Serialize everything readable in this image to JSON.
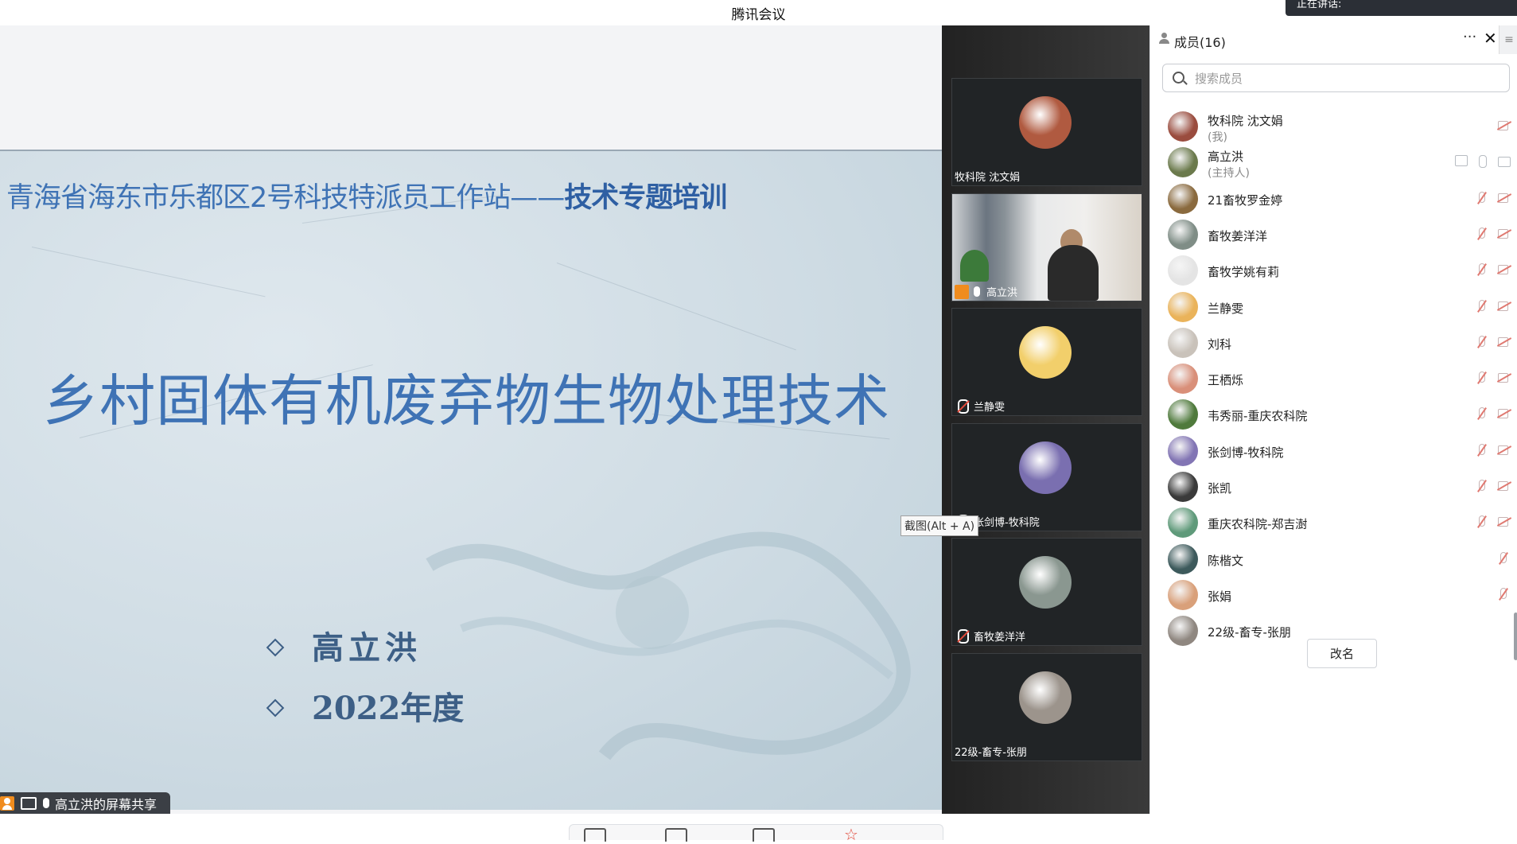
{
  "window": {
    "title": "腾讯会议",
    "recording_text": "正在讲话:"
  },
  "slide": {
    "header_normal": "青海省海东市乐都区2号科技特派员工作站——",
    "header_bold": "技术专题培训",
    "title": "乡村固体有机废弃物生物处理技术",
    "bullets": [
      "高立洪",
      "2022年度"
    ]
  },
  "share_bar": {
    "label": "高立洪的屏幕共享"
  },
  "tooltip": "截图(Alt + A)",
  "gallery": [
    {
      "name": "牧科院 沈文娟",
      "type": "avatar",
      "color": "#b05a40",
      "muted": false
    },
    {
      "name": "高立洪",
      "type": "video",
      "muted": false,
      "host": true
    },
    {
      "name": "兰静雯",
      "type": "avatar",
      "color": "#f2cf6b",
      "muted": true
    },
    {
      "name": "张剑博-牧科院",
      "type": "avatar",
      "color": "#7a6fb0",
      "muted": true
    },
    {
      "name": "畜牧姜洋洋",
      "type": "avatar",
      "color": "#8a9790",
      "muted": true
    },
    {
      "name": "22级-畜专-张朋",
      "type": "avatar",
      "color": "#9c948c",
      "muted": false
    }
  ],
  "panel": {
    "title": "成员(16)",
    "more_icon": "ellipsis-icon",
    "close_icon": "close-icon",
    "search_placeholder": "搜索成员",
    "members": [
      {
        "name": "牧科院 沈文娟",
        "role": "(我)",
        "color": "#9a4c3e",
        "status": "cam-off-only"
      },
      {
        "name": "高立洪",
        "role": "(主持人)",
        "color": "#6b7a4c",
        "status": "host-on"
      },
      {
        "name": "21畜牧罗金婷",
        "role": "",
        "color": "#8a6a3e",
        "status": "muted-cam-off"
      },
      {
        "name": "畜牧姜洋洋",
        "role": "",
        "color": "#7f8d86",
        "status": "muted-cam-off"
      },
      {
        "name": "畜牧学姚有莉",
        "role": "",
        "color": "#e4e4e4",
        "status": "muted-cam-off"
      },
      {
        "name": "兰静雯",
        "role": "",
        "color": "#eab35a",
        "status": "muted-cam-off"
      },
      {
        "name": "刘科",
        "role": "",
        "color": "#c9c2ba",
        "status": "muted-cam-off"
      },
      {
        "name": "王栖烁",
        "role": "",
        "color": "#d98f79",
        "status": "muted-cam-off"
      },
      {
        "name": "韦秀丽-重庆农科院",
        "role": "",
        "color": "#4f7a3c",
        "status": "muted-cam-off"
      },
      {
        "name": "张剑博-牧科院",
        "role": "",
        "color": "#8275b4",
        "status": "muted-cam-off"
      },
      {
        "name": "张凯",
        "role": "",
        "color": "#3a3a3a",
        "status": "muted-cam-off"
      },
      {
        "name": "重庆农科院-郑吉澍",
        "role": "",
        "color": "#5f9a7a",
        "status": "muted-cam-off"
      },
      {
        "name": "陈楷文",
        "role": "",
        "color": "#3d5a5c",
        "status": "muted-only"
      },
      {
        "name": "张娟",
        "role": "",
        "color": "#d9a07a",
        "status": "muted-only"
      },
      {
        "name": "22级-畜专-张朋",
        "role": "",
        "color": "#8f8780",
        "status": "none"
      }
    ],
    "rename_label": "改名"
  }
}
